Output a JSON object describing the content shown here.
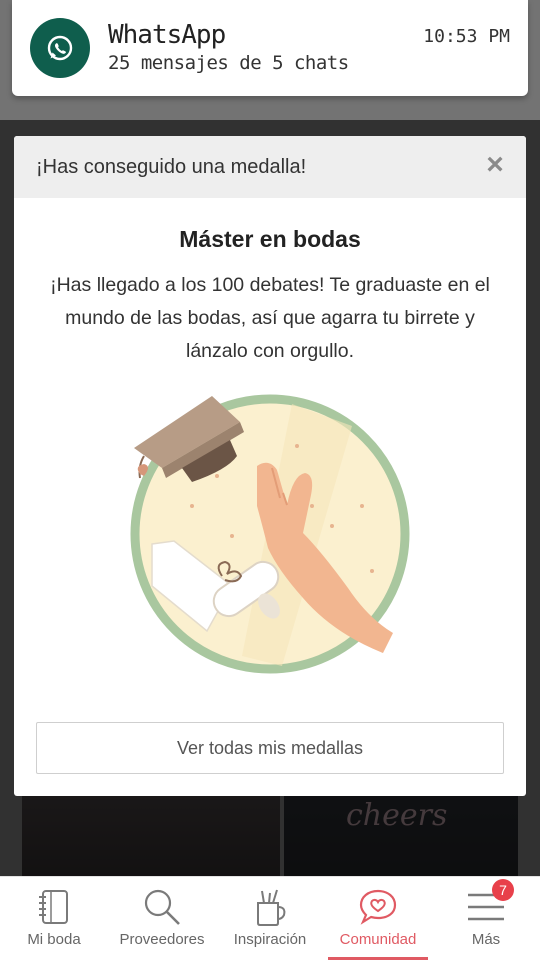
{
  "notification": {
    "app": "WhatsApp",
    "body": "25 mensajes de 5 chats",
    "time": "10:53 PM",
    "icon": "whatsapp-icon",
    "color": "#0f5e4d"
  },
  "modal": {
    "header": "¡Has conseguido una medalla!",
    "close_icon": "close-icon",
    "title": "Máster en bodas",
    "text": "¡Has llegado a los 100 debates! Te graduaste en el mundo de las bodas, así que agarra tu birrete y lánzalo con orgullo.",
    "button": "Ver todas mis medallas",
    "medal_icon": "graduation-cap-medal-icon"
  },
  "background": {
    "photo_script": "cheers"
  },
  "bottom_nav": {
    "items": [
      {
        "label": "Mi boda",
        "icon": "notebook-icon"
      },
      {
        "label": "Proveedores",
        "icon": "search-icon"
      },
      {
        "label": "Inspiración",
        "icon": "pencil-cup-icon"
      },
      {
        "label": "Comunidad",
        "icon": "chat-heart-icon",
        "active": true
      },
      {
        "label": "Más",
        "icon": "menu-icon",
        "badge": "7"
      }
    ],
    "accent": "#e05a63"
  }
}
